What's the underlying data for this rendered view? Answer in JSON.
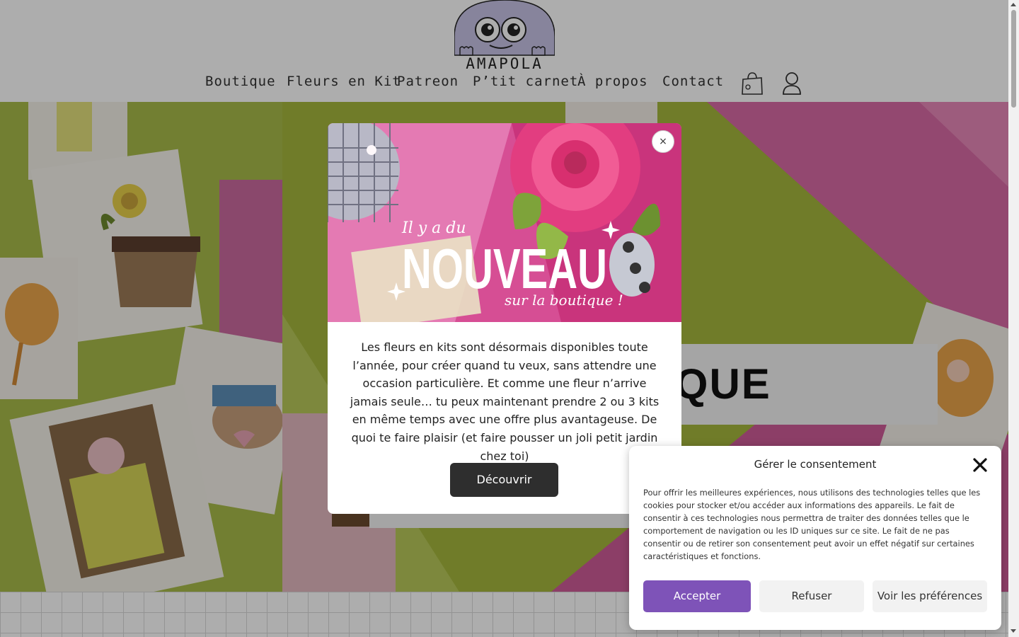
{
  "brand": {
    "name": "AMAPOLA"
  },
  "nav": {
    "items": [
      {
        "label": "Boutique"
      },
      {
        "label": "Fleurs en Kit"
      },
      {
        "label": "Patreon"
      },
      {
        "label": "P’tit carnet"
      },
      {
        "label": "À propos"
      },
      {
        "label": "Contact"
      }
    ],
    "icons": [
      "shopping-bag-icon",
      "user-icon"
    ]
  },
  "hero": {
    "title": "BOUTIQUE"
  },
  "promo_modal": {
    "image_text": {
      "line1": "Il y a du",
      "headline": "NOUVEAU",
      "line3": "sur la boutique !"
    },
    "close_label": "×",
    "body": "Les fleurs en kits sont désormais disponibles toute l’année, pour créer quand tu veux, sans attendre une occasion particulière. Et comme une fleur n’arrive jamais seule… tu peux maintenant prendre 2 ou 3 kits en même temps avec une offre plus avantageuse. De quoi te faire plaisir (et faire pousser un joli petit jardin chez toi)",
    "button_label": "Découvrir"
  },
  "cookie_banner": {
    "title": "Gérer le consentement",
    "text": "Pour offrir les meilleures expériences, nous utilisons des technologies telles que les cookies pour stocker et/ou accéder aux informations des appareils. Le fait de consentir à ces technologies nous permettra de traiter des données telles que le comportement de navigation ou les ID uniques sur ce site. Le fait de ne pas consentir ou de retirer son consentement peut avoir un effet négatif sur certaines caractéristiques et fonctions.",
    "accept_label": "Accepter",
    "refuse_label": "Refuser",
    "prefs_label": "Voir les préférences"
  },
  "colors": {
    "accent_purple": "#7e53b8",
    "button_dark": "#2e2e2e",
    "hero_green": "#a6b63b",
    "hero_pink": "#d86aa6"
  }
}
